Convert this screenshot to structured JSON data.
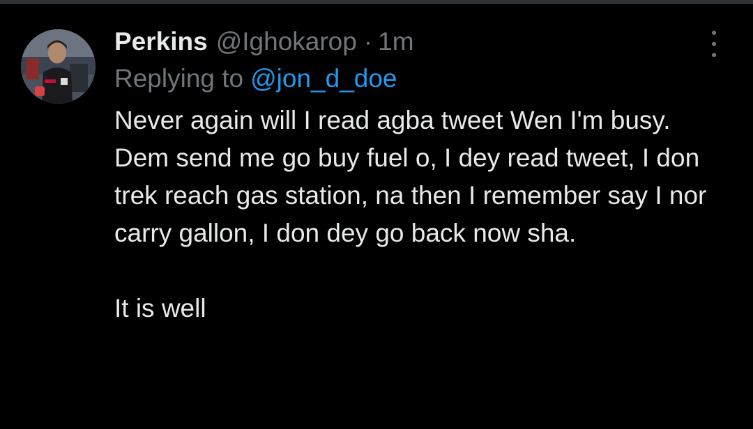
{
  "tweet": {
    "author_name": "Perkins",
    "handle": "@Ighokarop",
    "separator": "·",
    "time": "1m",
    "replying_prefix": "Replying to",
    "replying_to": "@jon_d_doe",
    "lines": [
      "Never again will I read agba tweet Wen I'm busy.",
      "Dem send me go buy fuel o, I dey read tweet, I don trek reach gas station, na then I remember say I nor carry gallon, I don dey go back now sha."
    ],
    "closing": "It is well"
  },
  "icons": {
    "avatar": "profile-photo",
    "more": "more-options-icon"
  },
  "colors": {
    "background": "#000000",
    "text_primary": "#e7e9ea",
    "text_secondary": "#71767b",
    "link": "#1d9bf0"
  }
}
